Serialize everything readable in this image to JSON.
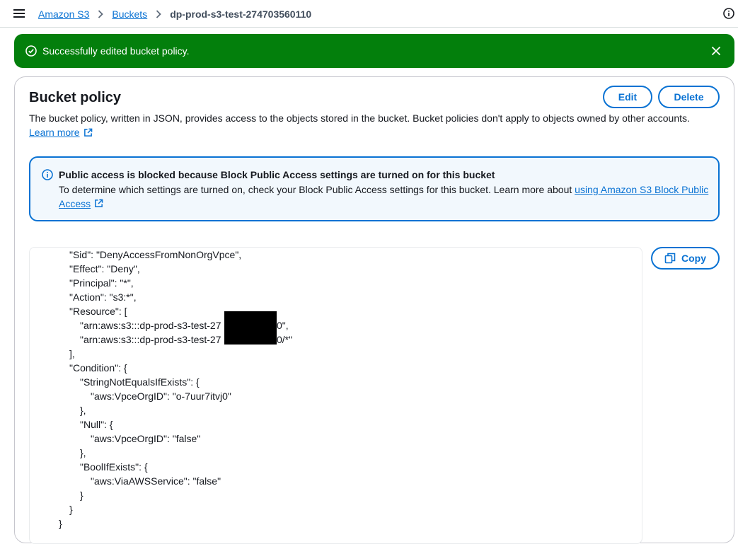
{
  "breadcrumb": {
    "items": [
      "Amazon S3",
      "Buckets"
    ],
    "current": "dp-prod-s3-test-274703560110"
  },
  "flash": {
    "message": "Successfully edited bucket policy.",
    "type": "success",
    "color": "#037f0c"
  },
  "panel": {
    "title": "Bucket policy",
    "edit_label": "Edit",
    "delete_label": "Delete",
    "description": "The bucket policy, written in JSON, provides access to the objects stored in the bucket. Bucket policies don't apply to objects owned by other accounts.",
    "learn_more": "Learn more"
  },
  "alert": {
    "title": "Public access is blocked because Block Public Access settings are turned on for this bucket",
    "body": "To determine which settings are turned on, check your Block Public Access settings for this bucket. Learn more about ",
    "link": "using Amazon S3 Block Public Access",
    "color": "#0972d3"
  },
  "policy": {
    "copy_label": "Copy",
    "lines": [
      "\"Sid\": \"DenyAccessFromNonOrgVpce\",",
      "\"Effect\": \"Deny\",",
      "\"Principal\": \"*\",",
      "\"Action\": \"s3:*\",",
      "\"Resource\": [",
      "\"arn:aws:s3:::dp-prod-s3-test-27",
      "0\",",
      "\"arn:aws:s3:::dp-prod-s3-test-27",
      "0/*\"",
      "],",
      "\"Condition\": {",
      "\"StringNotEqualsIfExists\": {",
      "\"aws:VpceOrgID\": \"o-7uur7itvj0\"",
      "},",
      "\"Null\": {",
      "\"aws:VpceOrgID\": \"false\"",
      "},",
      "\"BoolIfExists\": {",
      "\"aws:ViaAWSService\": \"false\"",
      "}",
      "}",
      "}"
    ]
  },
  "icons": {
    "menu": "hamburger-menu-icon",
    "info": "info-icon",
    "success": "check-circle-icon",
    "close": "close-icon",
    "external": "external-link-icon",
    "copy": "copy-icon"
  }
}
